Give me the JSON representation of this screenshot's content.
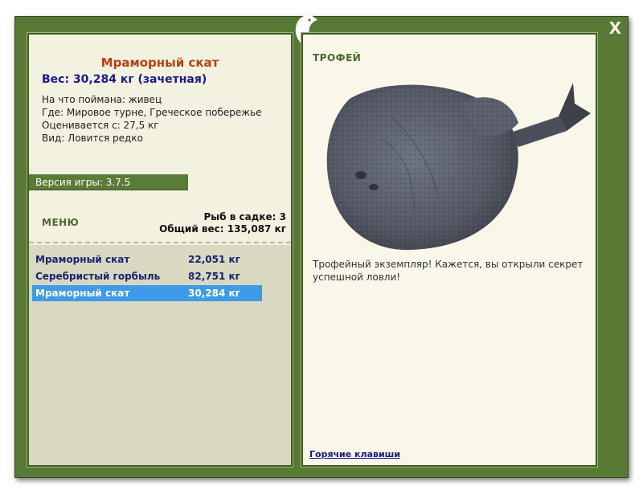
{
  "window": {
    "close_label": "X"
  },
  "fish": {
    "title": "Мраморный скат",
    "weight": "Вес: 30,284 кг (зачетная)",
    "bait": "На что поймана: живец",
    "location": "Где: Мировое турне, Греческое побережье",
    "valued": "Оценивается с: 27,5 кг",
    "kind": "Вид: Ловится редко"
  },
  "version": "Версия игры: 3.7.5",
  "menu_label": "МЕНЮ",
  "stats": {
    "count": "Рыб в садке: 3",
    "total": "Общий вес: 135,087 кг"
  },
  "catch_list": [
    {
      "name": "Мраморный скат",
      "weight": "22,051 кг"
    },
    {
      "name": "Серебристый горбыль",
      "weight": "82,751 кг"
    },
    {
      "name": "Мраморный скат",
      "weight": "30,284 кг"
    }
  ],
  "trophy": {
    "label": "ТРОФЕЙ",
    "text": "Трофейный экземпляр! Кажется, вы открыли секрет успешной ловли!"
  },
  "hotkeys": "Горячие клавиши",
  "colors": {
    "frame": "#587a35",
    "panel": "#f3f1e0",
    "selected": "#3d9be9",
    "title": "#b8420e",
    "navy": "#1a1a8c"
  }
}
